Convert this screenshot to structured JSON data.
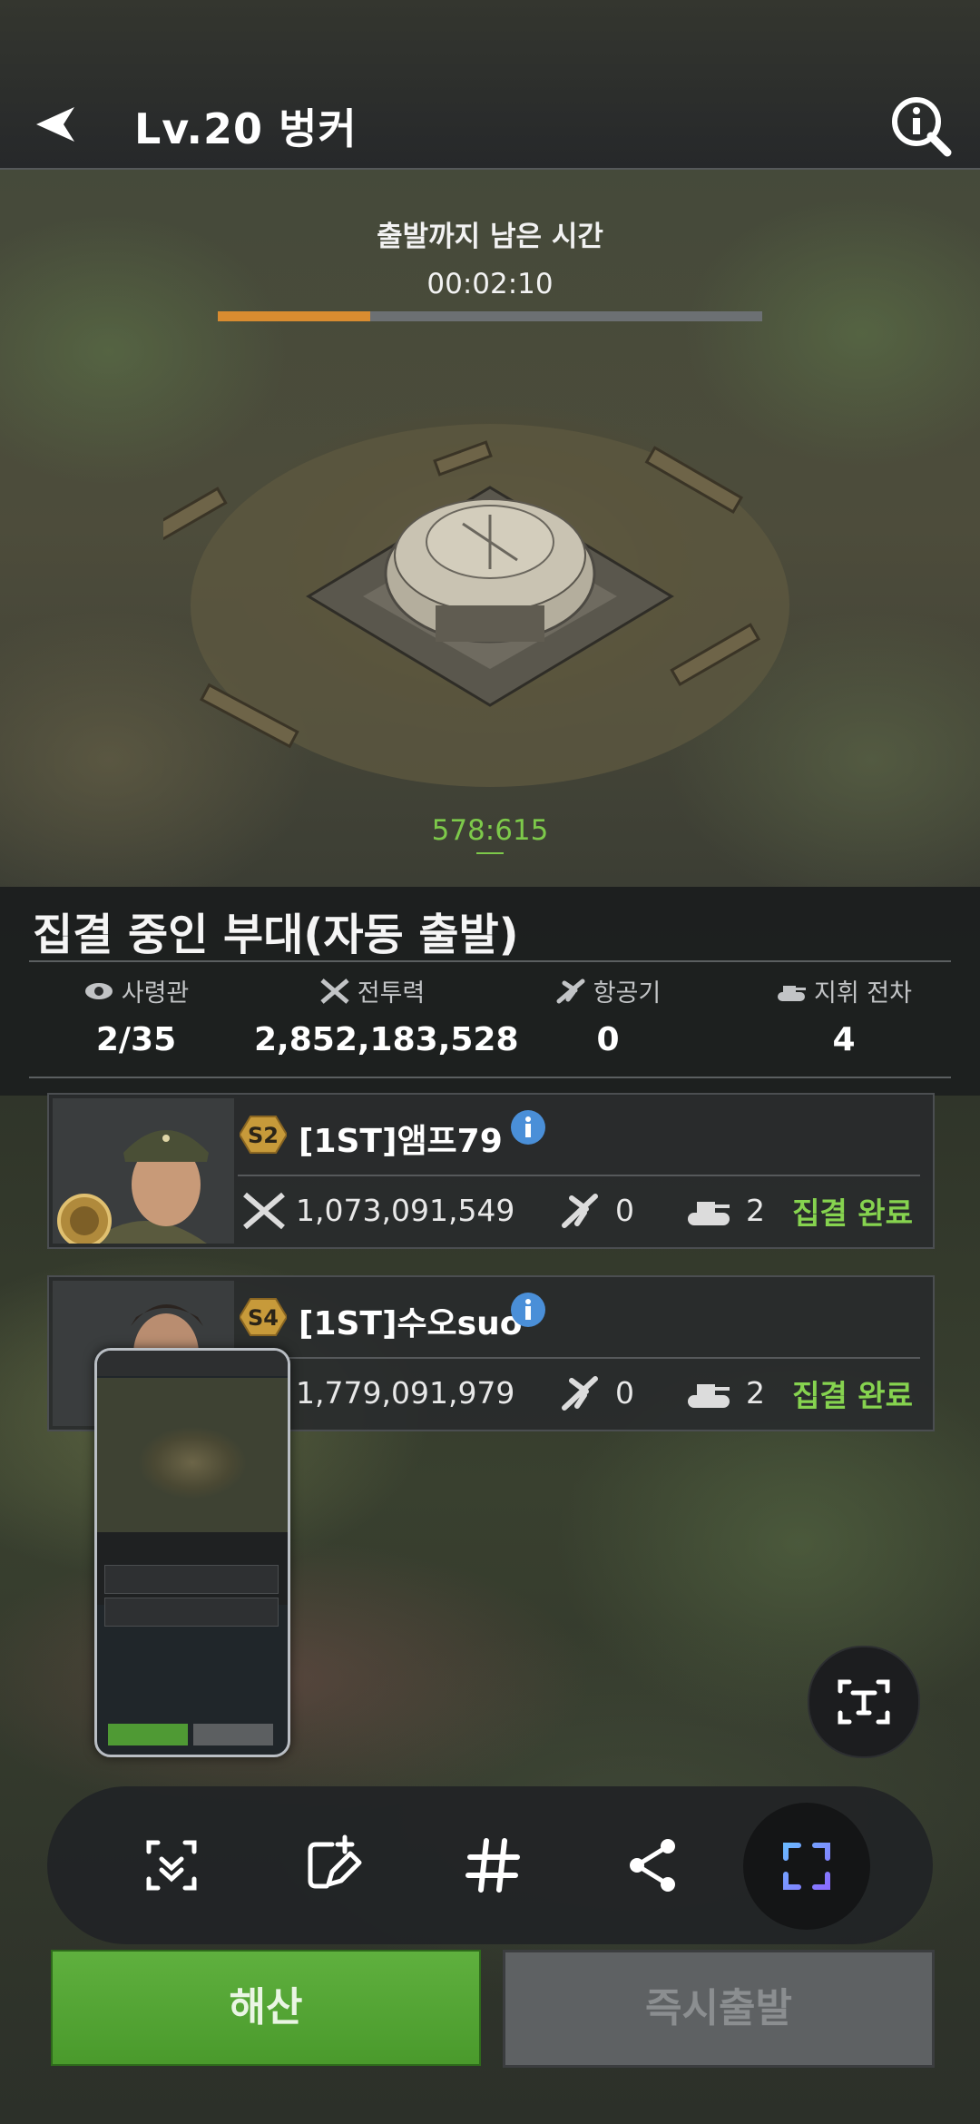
{
  "header": {
    "title": "Lv.20 벙커"
  },
  "march": {
    "countdown_label": "출발까지 남은 시간",
    "countdown_time": "00:02:10",
    "progress": 0.28,
    "coords": "578:615"
  },
  "section_title": "집결 중인 부대(자동 출발)",
  "stats": {
    "commanders_label": "사령관",
    "commanders_value": "2/35",
    "power_label": "전투력",
    "power_value": "2,852,183,528",
    "aircraft_label": "항공기",
    "aircraft_value": "0",
    "tank_label": "지휘 전차",
    "tank_value": "4"
  },
  "members": [
    {
      "season": "S2",
      "name": "[1ST]앰프79",
      "power": "1,073,091,549",
      "aircraft": "0",
      "tanks": "2",
      "status": "집결 완료"
    },
    {
      "season": "S4",
      "name": "[1ST]수오suo",
      "power": "1,779,091,979",
      "aircraft": "0",
      "tanks": "2",
      "status": "집결 완료"
    }
  ],
  "buttons": {
    "disband": "해산",
    "dispatch": "즉시출발"
  },
  "colors": {
    "accent_green": "#86d34f",
    "progress_orange": "#d98c30",
    "disband_green": "#4f9a34"
  },
  "icons": [
    "back-arrow-icon",
    "info-icon",
    "eye-icon",
    "crossed-swords-icon",
    "plane-icon",
    "tank-icon",
    "scan-icon",
    "edit-icon",
    "hashtag-icon",
    "share-icon",
    "capture-icon",
    "text-recognition-icon"
  ]
}
